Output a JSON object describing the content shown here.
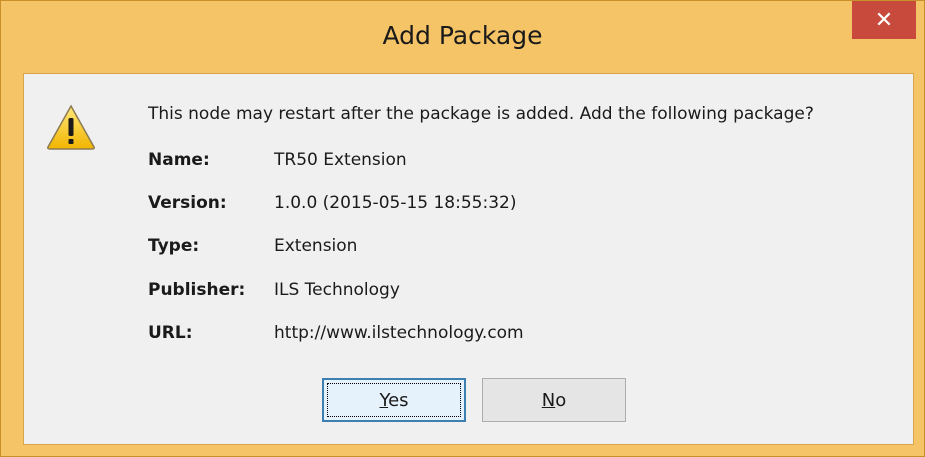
{
  "dialog": {
    "title": "Add Package",
    "close_glyph": "✕",
    "message": "This node may restart after the package is added. Add the following package?",
    "icon": "warning-icon",
    "fields": [
      {
        "label": "Name:",
        "value": "TR50 Extension"
      },
      {
        "label": "Version:",
        "value": "1.0.0 (2015-05-15 18:55:32)"
      },
      {
        "label": "Type:",
        "value": "Extension"
      },
      {
        "label": "Publisher:",
        "value": "ILS Technology"
      },
      {
        "label": "URL:",
        "value": "http://www.ilstechnology.com"
      }
    ],
    "buttons": {
      "yes_mnemonic": "Y",
      "yes_rest": "es",
      "no_mnemonic": "N",
      "no_rest": "o"
    }
  },
  "colors": {
    "frame": "#f5c466",
    "close": "#c74a3d",
    "client": "#f0f0f0",
    "default_button_border": "#3c7fb1"
  }
}
